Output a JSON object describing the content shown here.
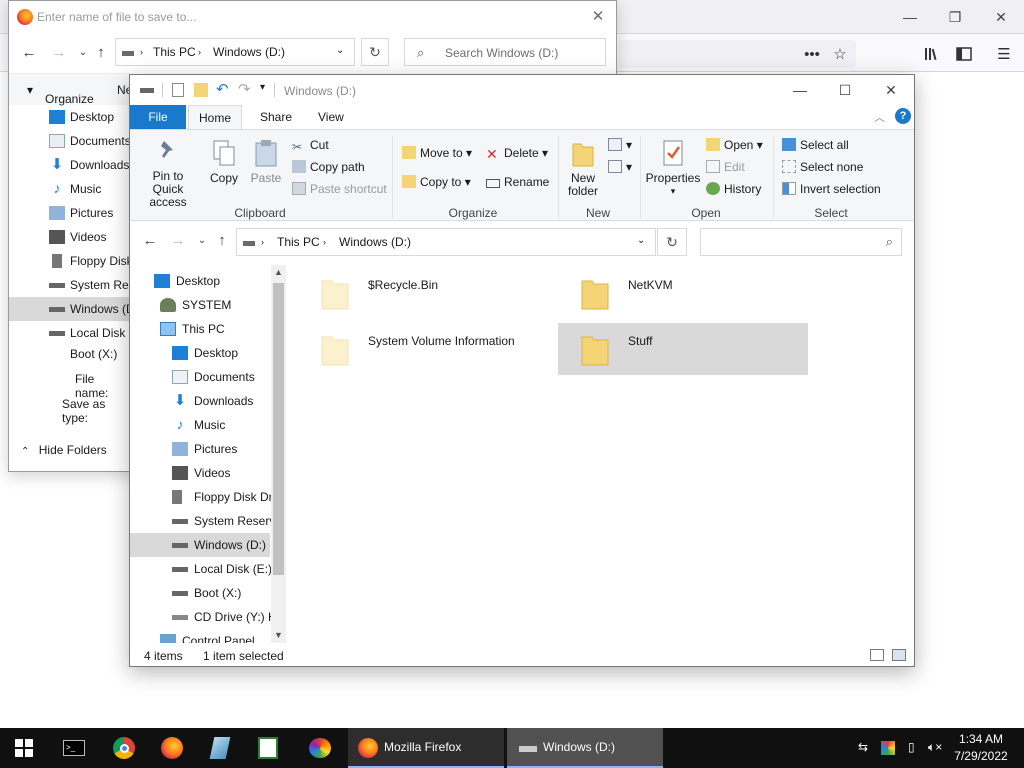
{
  "firefox": {
    "window_controls": {
      "minimize": "—",
      "restore": "❐",
      "close": "✕"
    },
    "toolbar_icons": [
      "more-icon",
      "star-icon",
      "library-icon",
      "sidebar-icon",
      "menu-icon"
    ]
  },
  "save_dialog": {
    "filename_placeholder": "Enter name of file to save to...",
    "address": [
      "This PC",
      "Windows (D:)"
    ],
    "search_placeholder": "Search Windows (D:)",
    "organize": "Organize",
    "new_folder_partial": "Ne",
    "sidebar": [
      "Desktop",
      "Documents",
      "Downloads",
      "Music",
      "Pictures",
      "Videos",
      "Floppy Disk",
      "System Rese",
      "Windows (D",
      "Local Disk (",
      "Boot (X:)"
    ],
    "file_name_label": "File name:",
    "save_type_label": "Save as type:",
    "hide_folders": "Hide Folders"
  },
  "explorer": {
    "title": "Windows (D:)",
    "tabs": [
      "File",
      "Home",
      "Share",
      "View"
    ],
    "ribbon": {
      "clipboard": {
        "pin_line1": "Pin to Quick",
        "pin_line2": "access",
        "copy": "Copy",
        "paste": "Paste",
        "cut": "Cut",
        "copy_path": "Copy path",
        "paste_shortcut": "Paste shortcut",
        "label": "Clipboard"
      },
      "organize": {
        "move_to": "Move to",
        "copy_to": "Copy to",
        "delete": "Delete",
        "rename": "Rename",
        "label": "Organize"
      },
      "new": {
        "new_folder_line1": "New",
        "new_folder_line2": "folder",
        "label": "New"
      },
      "open": {
        "properties": "Properties",
        "open": "Open",
        "edit": "Edit",
        "history": "History",
        "label": "Open"
      },
      "select": {
        "select_all": "Select all",
        "select_none": "Select none",
        "invert_selection": "Invert selection",
        "label": "Select"
      }
    },
    "address": [
      "This PC",
      "Windows (D:)"
    ],
    "search_placeholder": "",
    "tree": [
      {
        "label": "Desktop",
        "indent": 0,
        "icon": "desktop"
      },
      {
        "label": "SYSTEM",
        "indent": 1,
        "icon": "user"
      },
      {
        "label": "This PC",
        "indent": 1,
        "icon": "pc"
      },
      {
        "label": "Desktop",
        "indent": 2,
        "icon": "desktop"
      },
      {
        "label": "Documents",
        "indent": 2,
        "icon": "docs"
      },
      {
        "label": "Downloads",
        "indent": 2,
        "icon": "download"
      },
      {
        "label": "Music",
        "indent": 2,
        "icon": "music"
      },
      {
        "label": "Pictures",
        "indent": 2,
        "icon": "pictures"
      },
      {
        "label": "Videos",
        "indent": 2,
        "icon": "videos"
      },
      {
        "label": "Floppy Disk Dri",
        "indent": 2,
        "icon": "floppy"
      },
      {
        "label": "System Reserve",
        "indent": 2,
        "icon": "drive"
      },
      {
        "label": "Windows (D:)",
        "indent": 2,
        "icon": "drive",
        "selected": true
      },
      {
        "label": "Local Disk (E:)",
        "indent": 2,
        "icon": "drive"
      },
      {
        "label": "Boot (X:)",
        "indent": 2,
        "icon": "drive"
      },
      {
        "label": "CD Drive (Y:) H",
        "indent": 2,
        "icon": "cd"
      },
      {
        "label": "Control Panel",
        "indent": 1,
        "icon": "cpanel"
      }
    ],
    "files": [
      {
        "name": "$Recycle.Bin",
        "faded": true
      },
      {
        "name": "NetKVM",
        "faded": false
      },
      {
        "name": "System Volume Information",
        "faded": true
      },
      {
        "name": "Stuff",
        "faded": false,
        "selected": true
      }
    ],
    "status": {
      "count": "4 items",
      "selected": "1 item selected"
    }
  },
  "taskbar": {
    "tasks": [
      {
        "label": "Mozilla Firefox"
      },
      {
        "label": "Windows (D:)",
        "active": true
      }
    ],
    "time": "1:34 AM",
    "date": "7/29/2022"
  },
  "colors": {
    "accent": "#1979ca",
    "selection": "#d9d9d9",
    "taskbar": "#101010",
    "folder": "#f5d475"
  }
}
